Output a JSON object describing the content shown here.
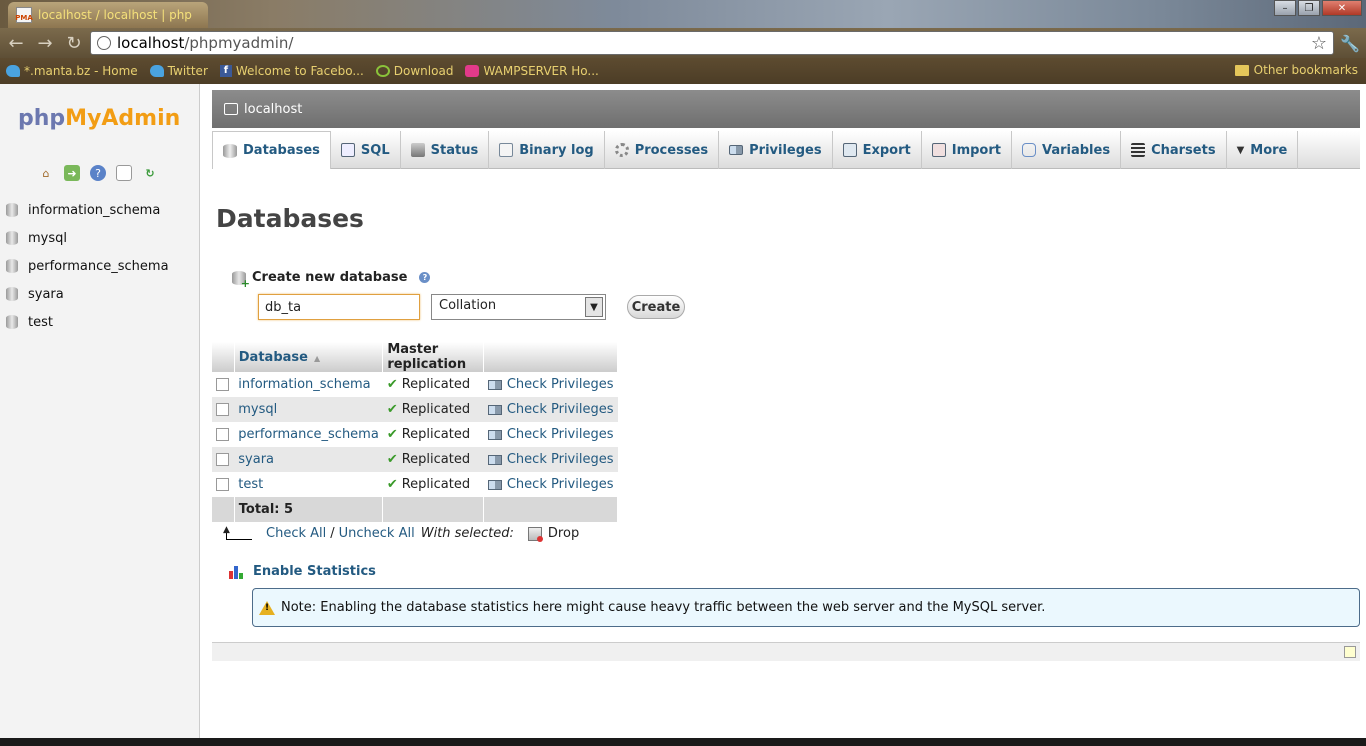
{
  "browser": {
    "tab_title": "localhost / localhost | php",
    "url_host": "localhost",
    "url_path": "/phpmyadmin/",
    "bookmarks": [
      {
        "label": "*.manta.bz - Home",
        "icon": "twitter-bird-icon",
        "color": "#4aa3e0"
      },
      {
        "label": "Twitter",
        "icon": "twitter-bird-icon",
        "color": "#4aa3e0"
      },
      {
        "label": "Welcome to Facebo...",
        "icon": "facebook-icon",
        "color": "#3b5998"
      },
      {
        "label": "Download",
        "icon": "download-icon",
        "color": "#8ac33a"
      },
      {
        "label": "WAMPSERVER Ho...",
        "icon": "wampserver-icon",
        "color": "#e23a8a"
      }
    ],
    "other_bookmarks": "Other bookmarks"
  },
  "sidebar": {
    "logo_php": "php",
    "logo_myadmin": "MyAdmin",
    "icons": [
      "home-icon",
      "exit-icon",
      "help-icon",
      "docs-icon",
      "reload-icon"
    ],
    "databases": [
      "information_schema",
      "mysql",
      "performance_schema",
      "syara",
      "test"
    ]
  },
  "main": {
    "server_label": "localhost",
    "tabs": [
      {
        "label": "Databases",
        "icon": "databases-icon",
        "active": true
      },
      {
        "label": "SQL",
        "icon": "sql-icon"
      },
      {
        "label": "Status",
        "icon": "status-icon"
      },
      {
        "label": "Binary log",
        "icon": "binary-log-icon"
      },
      {
        "label": "Processes",
        "icon": "processes-icon"
      },
      {
        "label": "Privileges",
        "icon": "privileges-icon"
      },
      {
        "label": "Export",
        "icon": "export-icon"
      },
      {
        "label": "Import",
        "icon": "import-icon"
      },
      {
        "label": "Variables",
        "icon": "variables-icon"
      },
      {
        "label": "Charsets",
        "icon": "charsets-icon"
      },
      {
        "label": "More",
        "icon": "more-caret-icon"
      }
    ],
    "page_title": "Databases",
    "create": {
      "label": "Create new database",
      "db_name_value": "db_ta",
      "collation_value": "Collation",
      "button": "Create"
    },
    "table": {
      "headers": [
        "Database",
        "Master replication"
      ],
      "rows": [
        {
          "name": "information_schema",
          "replication": "Replicated",
          "action": "Check Privileges"
        },
        {
          "name": "mysql",
          "replication": "Replicated",
          "action": "Check Privileges"
        },
        {
          "name": "performance_schema",
          "replication": "Replicated",
          "action": "Check Privileges"
        },
        {
          "name": "syara",
          "replication": "Replicated",
          "action": "Check Privileges"
        },
        {
          "name": "test",
          "replication": "Replicated",
          "action": "Check Privileges"
        }
      ],
      "total": "Total: 5"
    },
    "bulk": {
      "check_all": "Check All",
      "separator": "/",
      "uncheck_all": "Uncheck All",
      "with_selected": "With selected:",
      "drop": "Drop"
    },
    "enable_statistics": "Enable Statistics",
    "notice": "Note: Enabling the database statistics here might cause heavy traffic between the web server and the MySQL server."
  }
}
